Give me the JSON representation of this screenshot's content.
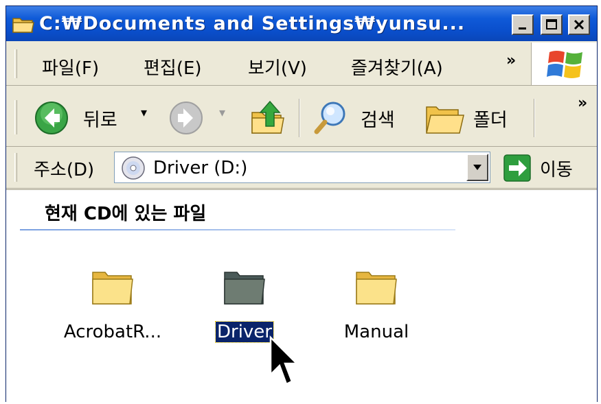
{
  "window": {
    "title": "C:₩Documents and Settings₩yunsu...",
    "minimize_symbol": "_",
    "maximize_symbol": "□",
    "close_symbol": "×"
  },
  "menu": {
    "items": [
      "파일(F)",
      "편집(E)",
      "보기(V)",
      "즐겨찾기(A)"
    ],
    "overflow": "»"
  },
  "toolbar": {
    "back_label": "뒤로",
    "search_label": "검색",
    "folders_label": "폴더",
    "overflow": "»",
    "dropdown_arrow": "▾"
  },
  "address_bar": {
    "label": "주소(D)",
    "value": "Driver (D:)",
    "go_label": "이동"
  },
  "content": {
    "group_header": "현재 CD에 있는 파일",
    "items": [
      {
        "label": "AcrobatR...",
        "selected": false
      },
      {
        "label": "Driver",
        "selected": true
      },
      {
        "label": "Manual",
        "selected": false
      }
    ]
  },
  "colors": {
    "titlebar": "#0a4fcc",
    "selection": "#0a246a",
    "folder": "#f5d76e",
    "go_green": "#2e9e3e"
  }
}
